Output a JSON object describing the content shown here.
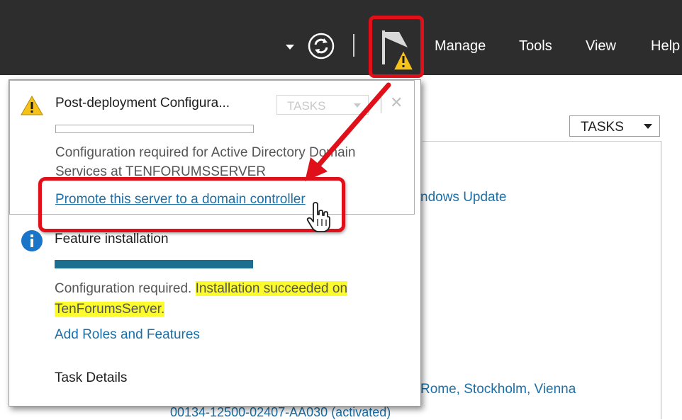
{
  "toolbar": {
    "menu": [
      "Manage",
      "Tools",
      "View",
      "Help"
    ],
    "icons": [
      "dropdown-arrow-icon",
      "refresh-icon",
      "flag-icon",
      "warning-icon"
    ]
  },
  "background": {
    "tasks_label": "TASKS",
    "link_windows_update": "ndows Update",
    "link_timezone": "Rome, Stockholm, Vienna",
    "product_id": "00134-12500-02407-AA030 (activated)"
  },
  "notifications": {
    "item1": {
      "title": "Post-deployment Configura...",
      "tasks_label": "TASKS",
      "close": "✕",
      "message_line1": "Configuration required for Active Directory Domain",
      "message_line2": "Services at TENFORUMSSERVER",
      "action_link": "Promote this server to a domain controller",
      "progress": 0
    },
    "item2": {
      "title": "Feature installation",
      "progress": 1.0,
      "message_part1": "Configuration required.",
      "message_highlight1": "Installation succeeded on",
      "message_highlight2": "TenForumsServer.",
      "action_link": "Add Roles and Features"
    },
    "task_details": "Task Details"
  },
  "colors": {
    "topbar": "#2d2d2d",
    "annotation_red": "#e0101a",
    "link_blue": "#1b6fa6",
    "highlight_yellow": "#fbfb2e",
    "progress_teal": "#1c6f8f"
  }
}
